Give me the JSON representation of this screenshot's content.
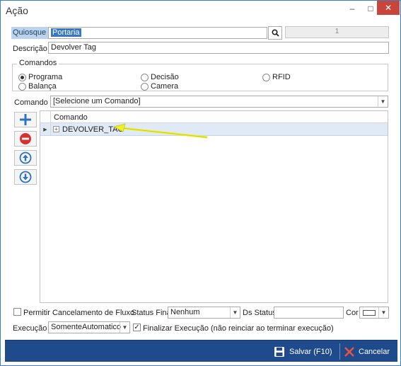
{
  "window": {
    "title": "Ação",
    "minimize": "–",
    "maximize": "□",
    "close": "✕"
  },
  "quiosque": {
    "label": "Quiosque",
    "value": "Portaria",
    "number": "1"
  },
  "descricao": {
    "label": "Descrição",
    "value": "Devolver Tag"
  },
  "comandos_group": {
    "title": "Comandos",
    "options": [
      "Programa",
      "Decisão",
      "RFID",
      "Balança",
      "Camera"
    ],
    "selected": "Programa"
  },
  "comando": {
    "label": "Comando",
    "value": "[Selecione um Comando]"
  },
  "grid": {
    "column": "Comando",
    "rows": [
      {
        "name": "DEVOLVER_TAG",
        "expander": "+",
        "indicator": "▶"
      }
    ],
    "annotation_color": "#f2ee2a"
  },
  "side_buttons": [
    "add-icon",
    "remove-icon",
    "move-up-icon",
    "move-down-icon"
  ],
  "bottom": {
    "permitir_label": "Permitir Cancelamento de Fluxo",
    "permitir_checked": false,
    "status_final_label": "Status Final",
    "status_final_value": "Nenhum",
    "ds_status_label": "Ds Status",
    "ds_status_value": "",
    "cor_label": "Cor",
    "execucao_label": "Execução",
    "execucao_value": "SomenteAutomatico",
    "finalizar_label": "Finalizar Execução (não reinciar ao terminar execução)",
    "finalizar_checked": true,
    "check_mark": "✓"
  },
  "footer": {
    "save_label": "Salvar (F10)",
    "cancel_label": "Cancelar",
    "bg": "#1f4a8c"
  }
}
